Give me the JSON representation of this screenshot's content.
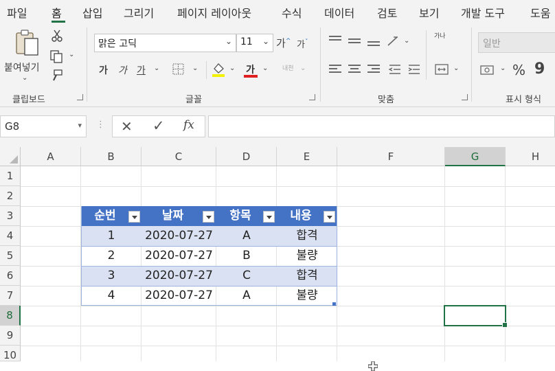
{
  "menu": {
    "tabs": [
      "파일",
      "홈",
      "삽입",
      "그리기",
      "페이지 레이아웃",
      "수식",
      "데이터",
      "검토",
      "보기",
      "개발 도구",
      "도움"
    ],
    "active": "홈"
  },
  "ribbon": {
    "clipboard": {
      "paste_label": "붙여넣기",
      "group_label": "클립보드"
    },
    "font": {
      "font_name": "맑은 고딕",
      "font_size": "11",
      "grow_label": "가",
      "shrink_label": "가",
      "bold_label": "가",
      "italic_label": "가",
      "underline_label": "가",
      "font_color_label": "가",
      "phonetic_label": "내천",
      "group_label": "글꼴",
      "font_color": "#e02020",
      "fill_color": "#f2f200"
    },
    "alignment": {
      "wrap_label": "가나",
      "group_label": "맞춤"
    },
    "number": {
      "format_value": "일반",
      "percent_label": "%",
      "comma_label": "9",
      "group_label": "표시 형식"
    }
  },
  "formula_bar": {
    "name_box": "G8",
    "cancel_icon": "✕",
    "enter_icon": "✓",
    "fx_label": "fx",
    "formula": ""
  },
  "grid": {
    "columns": [
      "A",
      "B",
      "C",
      "D",
      "E",
      "F",
      "G",
      "H"
    ],
    "rows": [
      "1",
      "2",
      "3",
      "4",
      "5",
      "6",
      "7",
      "8",
      "9",
      "10"
    ],
    "selected_cell": "G8"
  },
  "table": {
    "headers": [
      "순번",
      "날짜",
      "항목",
      "내용"
    ],
    "rows": [
      [
        "1",
        "2020-07-27",
        "A",
        "합격"
      ],
      [
        "2",
        "2020-07-27",
        "B",
        "불량"
      ],
      [
        "3",
        "2020-07-27",
        "C",
        "합격"
      ],
      [
        "4",
        "2020-07-27",
        "A",
        "불량"
      ]
    ],
    "header_color": "#4472c4",
    "band_color": "#d9e1f2"
  }
}
